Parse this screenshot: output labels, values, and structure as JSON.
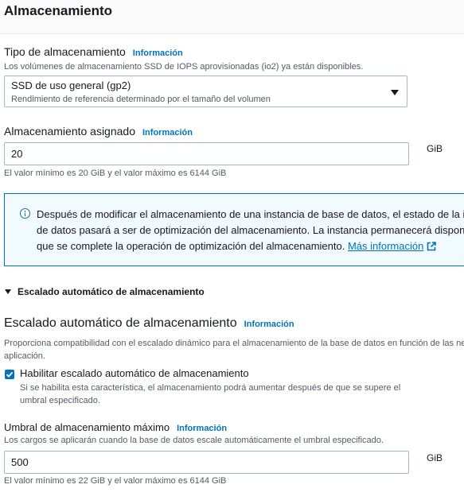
{
  "panel": {
    "title": "Almacenamiento"
  },
  "info_link": "Información",
  "storage_type": {
    "label": "Tipo de almacenamiento",
    "description": "Los volúmenes de almacenamiento SSD de IOPS aprovisionadas (io2) ya están disponibles.",
    "selected_value": "SSD de uso general (gp2)",
    "selected_description": "Rendimiento de referencia determinado por el tamaño del volumen"
  },
  "allocated_storage": {
    "label": "Almacenamiento asignado",
    "value": "20",
    "unit": "GiB",
    "constraint": "El valor mínimo es 20 GiB y el valor máximo es 6144 GiB"
  },
  "alert": {
    "line1": "Después de modificar el almacenamiento de una instancia de base de datos, el estado de la ins",
    "line2": "de datos pasará a ser de optimización del almacenamiento. La instancia permanecerá disponib",
    "line3": "que se complete la operación de optimización del almacenamiento.",
    "link_text": "Más información"
  },
  "autoscaling_expander": {
    "label": "Escalado automático de almacenamiento"
  },
  "autoscaling": {
    "title": "Escalado automático de almacenamiento",
    "description_line1": "Proporciona compatibilidad con el escalado dinámico para el almacenamiento de la base de datos en función de las ne",
    "description_line2": "aplicación.",
    "checkbox_checked": true,
    "checkbox_label": "Habilitar escalado automático de almacenamiento",
    "checkbox_description_line1": "Si se habilita esta característica, el almacenamiento podrá aumentar después de que se supere el",
    "checkbox_description_line2": "umbral especificado."
  },
  "max_threshold": {
    "label": "Umbral de almacenamiento máximo",
    "description": "Los cargos se aplicarán cuando la base de datos escale automáticamente el umbral especificado.",
    "value": "500",
    "unit": "GiB",
    "constraint": "El valor mínimo es 22 GiB y el valor máximo es 6144 GiB"
  },
  "colors": {
    "link": "#0073bb",
    "alert_bg": "#f1faff",
    "alert_border": "#0073bb"
  },
  "icons": [
    "info-circle-icon",
    "external-link-icon",
    "caret-down-icon",
    "checkmark-icon"
  ]
}
